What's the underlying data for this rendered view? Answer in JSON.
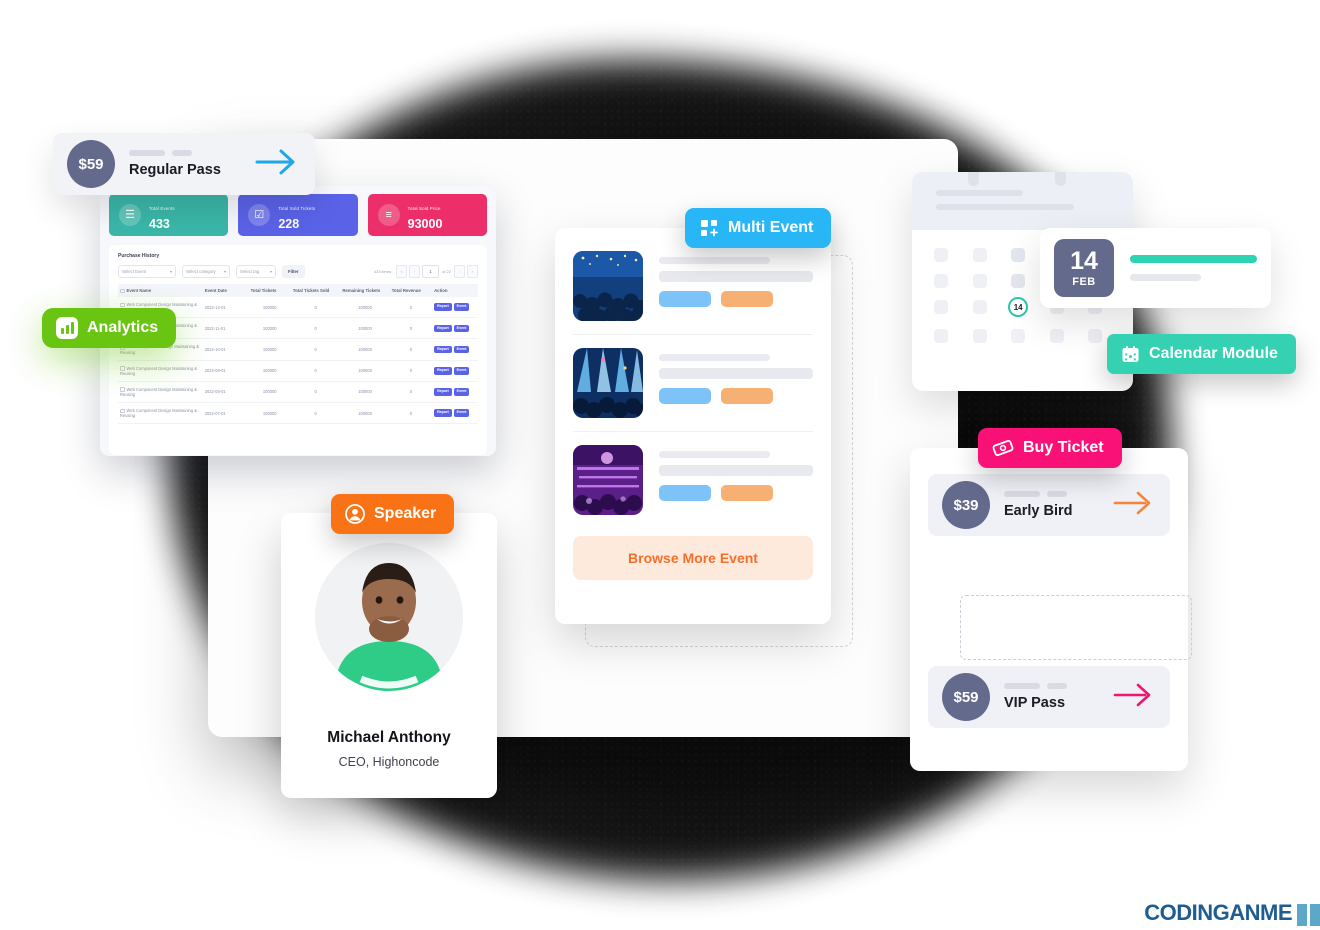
{
  "browser": {
    "dots": [
      {
        "name": "close-dot",
        "color": "#f0675d"
      },
      {
        "name": "minimize-dot",
        "color": "#f2b63c"
      },
      {
        "name": "maximize-dot",
        "color": "#5cc44a"
      }
    ]
  },
  "dashboard": {
    "stats": [
      {
        "label": "Total Events",
        "value": "433",
        "color": "#3ab7a8",
        "icon": "list-icon",
        "glyph": "☰"
      },
      {
        "label": "Total Sold Tickets",
        "value": "228",
        "color": "#5a63e8",
        "icon": "checklist-icon",
        "glyph": "☑"
      },
      {
        "label": "Total Sold Price",
        "value": "93000",
        "color": "#ec2f6a",
        "icon": "add-lines-icon",
        "glyph": "≡"
      }
    ],
    "panel_title": "Purchase History",
    "filters": [
      {
        "name": "select-event",
        "value": "Select Event"
      },
      {
        "name": "select-category",
        "value": "Select category"
      },
      {
        "name": "select-tag",
        "value": "Select tag"
      }
    ],
    "filter_button": "Filter",
    "pagination": {
      "items_text": "433 items",
      "first": "«",
      "prev": "‹",
      "current": "1",
      "of_text": "of 22",
      "next": "›",
      "last": "»"
    },
    "table": {
      "columns": [
        "Event Name",
        "Event Date",
        "Total Tickets",
        "Total Tickets Sold",
        "Remaining Tickets",
        "Total Revenue",
        "Action"
      ],
      "rows": [
        {
          "name": "Web Component Design Maintaining & Reusing",
          "date": "2022-12-01",
          "total": "100000",
          "sold": "0",
          "remaining": "100000",
          "revenue": "0",
          "actions": [
            "Report",
            "Event"
          ]
        },
        {
          "name": "Web Component Design Maintaining & Reusing",
          "date": "2022-11-01",
          "total": "100000",
          "sold": "0",
          "remaining": "100000",
          "revenue": "0",
          "actions": [
            "Report",
            "Event"
          ]
        },
        {
          "name": "Web Components Design Maintaining & Reusing",
          "date": "2022-10-01",
          "total": "100000",
          "sold": "0",
          "remaining": "100000",
          "revenue": "0",
          "actions": [
            "Report",
            "Event"
          ]
        },
        {
          "name": "Web Component Design Maintaining & Reusing",
          "date": "2022-09-01",
          "total": "100000",
          "sold": "0",
          "remaining": "100000",
          "revenue": "0",
          "actions": [
            "Report",
            "Event"
          ]
        },
        {
          "name": "Web Component Design Maintaining & Reusing",
          "date": "2022-08-01",
          "total": "100000",
          "sold": "0",
          "remaining": "100000",
          "revenue": "0",
          "actions": [
            "Report",
            "Event"
          ]
        },
        {
          "name": "Web Component Design Maintaining & Reusing",
          "date": "2022-07-01",
          "total": "100000",
          "sold": "0",
          "remaining": "100000",
          "revenue": "0",
          "actions": [
            "Report",
            "Event"
          ]
        }
      ]
    }
  },
  "pills": {
    "analytics": {
      "label": "Analytics",
      "icon": "bar-chart-icon",
      "color": "#6ac512"
    },
    "speaker": {
      "label": "Speaker",
      "icon": "user-circle-icon",
      "color": "#f97316"
    },
    "multi_event": {
      "label": "Multi Event",
      "icon": "grid-plus-icon",
      "color": "#29b6f6"
    },
    "calendar_module": {
      "label": "Calendar Module",
      "icon": "calendar-icon",
      "color": "#35d1b3"
    },
    "buy_ticket": {
      "label": "Buy Ticket",
      "icon": "ticket-icon",
      "color": "#fa1178"
    }
  },
  "speaker_card": {
    "name": "Michael Anthony",
    "role": "CEO, Highoncode",
    "avatar_alt": "speaker-portrait"
  },
  "events": {
    "items": [
      {
        "thumb": "concert-crowd-blue",
        "tag_primary": "",
        "tag_secondary": ""
      },
      {
        "thumb": "stage-lights-blue",
        "tag_primary": "",
        "tag_secondary": ""
      },
      {
        "thumb": "festival-purple",
        "tag_primary": "",
        "tag_secondary": ""
      }
    ],
    "browse_button": "Browse More Event"
  },
  "calendar": {
    "today": "14",
    "date_card": {
      "day": "14",
      "month": "FEB"
    },
    "accent": "#2ec7ab"
  },
  "pricing": {
    "tickets": [
      {
        "price": "$39",
        "name": "Early Bird",
        "arrow_color": "#f4853a",
        "featured": false
      },
      {
        "price": "$59",
        "name": "Regular Pass",
        "arrow_color": "#1fa7e8",
        "featured": true
      },
      {
        "price": "$59",
        "name": "VIP Pass",
        "arrow_color": "#f0156e",
        "featured": false
      }
    ]
  },
  "watermark": {
    "text": "CODINGANME"
  }
}
